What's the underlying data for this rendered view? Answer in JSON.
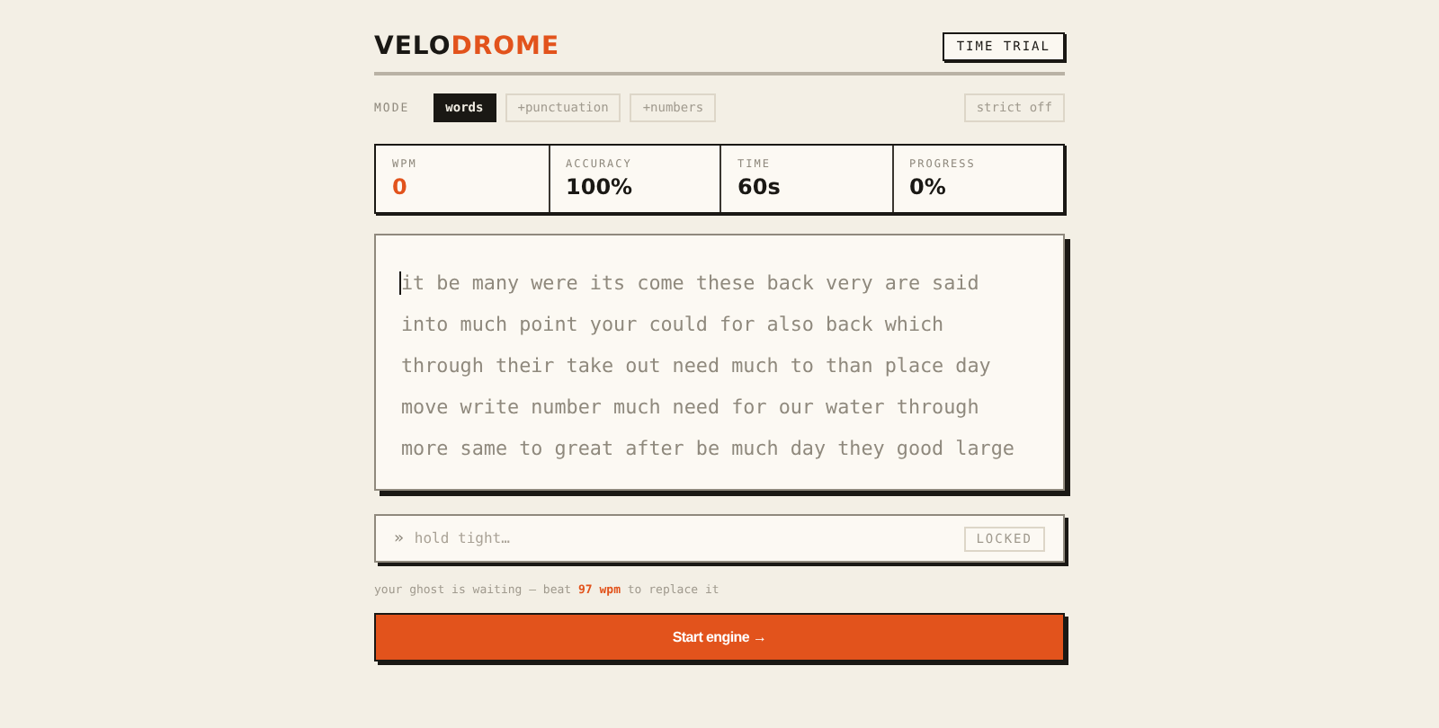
{
  "header": {
    "logo_main": "VELO",
    "logo_accent": "DROME",
    "badge": "TIME TRIAL"
  },
  "mode": {
    "label": "MODE",
    "options": [
      {
        "label": "words",
        "selected": true
      },
      {
        "label": "+punctuation",
        "selected": false
      },
      {
        "label": "+numbers",
        "selected": false
      }
    ],
    "strict": "strict off"
  },
  "stats": [
    {
      "label": "WPM",
      "value": "0",
      "highlight": true
    },
    {
      "label": "ACCURACY",
      "value": "100%",
      "highlight": false
    },
    {
      "label": "TIME",
      "value": "60s",
      "highlight": false
    },
    {
      "label": "PROGRESS",
      "value": "0%",
      "highlight": false
    }
  ],
  "passage": [
    "it be many were its come these back very are said",
    "into much point your could for also back which",
    "through their take out need much to than place day",
    "move write number much need for our water through",
    "more same to great after be much day they good large"
  ],
  "input": {
    "prompt": "»",
    "placeholder": "hold tight…",
    "status": "LOCKED"
  },
  "hint": "your ghost is waiting — beat **97 wpm** to replace it",
  "start_button": "Start engine →"
}
